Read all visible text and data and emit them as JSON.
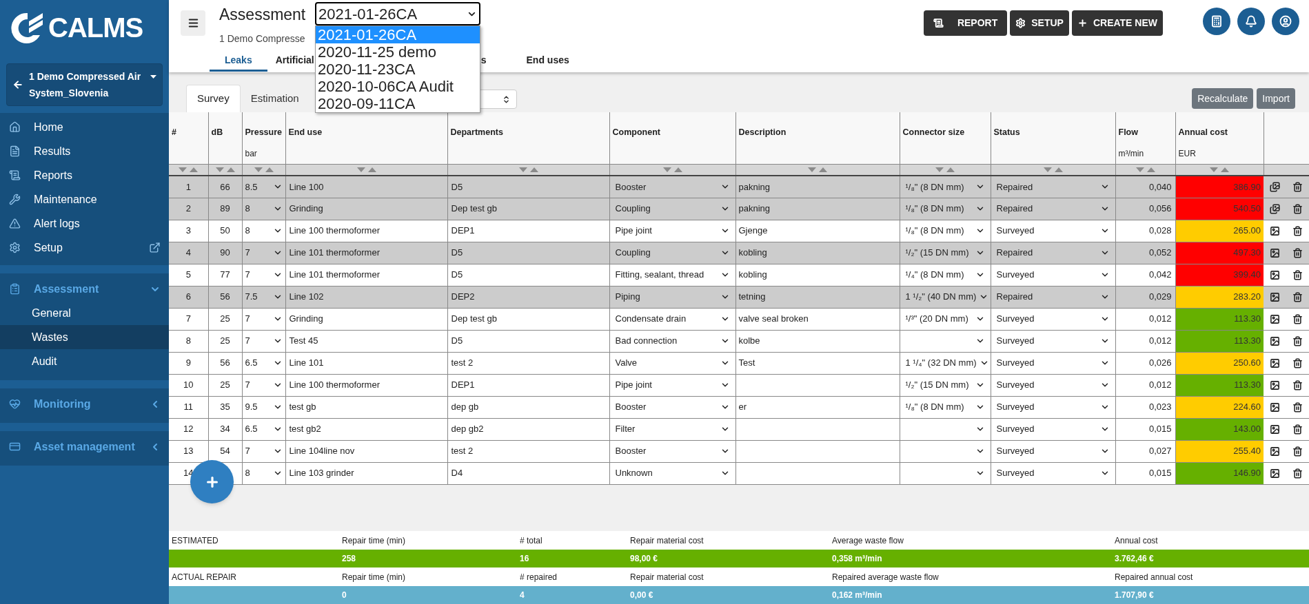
{
  "sidebar": {
    "logo": "CALMS",
    "project": "1 Demo Compressed Air System_Slovenia",
    "nav": [
      {
        "label": "Home",
        "external": false
      },
      {
        "label": "Results",
        "external": false
      },
      {
        "label": "Reports",
        "external": false
      },
      {
        "label": "Maintenance",
        "external": false
      },
      {
        "label": "Alert logs",
        "external": false
      },
      {
        "label": "Setup",
        "external": true
      }
    ],
    "sections": [
      {
        "label": "Assessment",
        "expanded": true,
        "children": [
          {
            "label": "General",
            "selected": false
          },
          {
            "label": "Wastes",
            "selected": true
          },
          {
            "label": "Audit",
            "selected": false
          }
        ]
      },
      {
        "label": "Monitoring",
        "expanded": false
      },
      {
        "label": "Asset management",
        "expanded": false
      }
    ]
  },
  "header": {
    "title": "Assessment",
    "subtitle": "1 Demo Compresse",
    "select": {
      "value": "2021-01-26CA",
      "expanded": true,
      "options": [
        {
          "label": "2021-01-26CA",
          "selected": true
        },
        {
          "label": "2020-11-25 demo",
          "selected": false
        },
        {
          "label": "2020-11-23CA",
          "selected": false
        },
        {
          "label": "2020-10-06CA Audit",
          "selected": false
        },
        {
          "label": "2020-09-11CA",
          "selected": false
        }
      ]
    },
    "tabs": [
      {
        "label": "Leaks",
        "selected": true
      },
      {
        "label": "Artificial",
        "selected": false
      },
      {
        "label": "s",
        "selected": false
      },
      {
        "label": "End uses",
        "selected": false
      }
    ],
    "buttons": [
      "REPORT",
      "SETUP",
      "CREATE NEW"
    ]
  },
  "subtabs": [
    {
      "label": "Survey",
      "selected": true
    },
    {
      "label": "Estimation",
      "selected": false
    }
  ],
  "actions": [
    "Recalculate",
    "Import"
  ],
  "table": {
    "columns": [
      {
        "label": "#"
      },
      {
        "label": "dB"
      },
      {
        "label": "Pressure",
        "unit": "bar"
      },
      {
        "label": "End use"
      },
      {
        "label": "Departments"
      },
      {
        "label": "Component"
      },
      {
        "label": "Description"
      },
      {
        "label": "Connector size"
      },
      {
        "label": "Status"
      },
      {
        "label": "Flow",
        "unit": "m³/min"
      },
      {
        "label": "Annual cost",
        "unit": "EUR"
      }
    ],
    "rows": [
      {
        "num": "1",
        "db": "66",
        "pressure": "8.5",
        "end_use": "Line 100",
        "department": "D5",
        "component": "Booster",
        "description": "pakning",
        "connector": "¹/₈\" (8 DN mm)",
        "status": "Repaired",
        "flow": "0,040",
        "annual_cost": "386.90",
        "color": "#ff0000",
        "repaired": true,
        "gallery": true
      },
      {
        "num": "2",
        "db": "89",
        "pressure": "8",
        "end_use": "Grinding",
        "department": "Dep test gb",
        "component": "Coupling",
        "description": "pakning",
        "connector": "¹/₈\" (8 DN mm)",
        "status": "Repaired",
        "flow": "0,056",
        "annual_cost": "540.50",
        "color": "#ff0000",
        "repaired": true,
        "gallery": true
      },
      {
        "num": "3",
        "db": "50",
        "pressure": "8",
        "end_use": "Line 100 thermoformer",
        "department": "DEP1",
        "component": "Pipe joint",
        "description": "Gjenge",
        "connector": "¹/₈\" (8 DN mm)",
        "status": "Surveyed",
        "flow": "0,028",
        "annual_cost": "265.00",
        "color": "#ffcc00",
        "repaired": false,
        "gallery": false
      },
      {
        "num": "4",
        "db": "90",
        "pressure": "7",
        "end_use": "Line 101 thermoformer",
        "department": "D5",
        "component": "Coupling",
        "description": "kobling",
        "connector": "¹/₂\" (15 DN mm)",
        "status": "Repaired",
        "flow": "0,052",
        "annual_cost": "497.30",
        "color": "#ff0000",
        "repaired": true,
        "gallery": false
      },
      {
        "num": "5",
        "db": "77",
        "pressure": "7",
        "end_use": "Line 101 thermoformer",
        "department": "D5",
        "component": "Fitting, sealant, thread",
        "description": "kobling",
        "connector": "¹/₄\" (8 DN mm)",
        "status": "Surveyed",
        "flow": "0,042",
        "annual_cost": "399.40",
        "color": "#ff0000",
        "repaired": false,
        "gallery": false
      },
      {
        "num": "6",
        "db": "56",
        "pressure": "7.5",
        "end_use": "Line 102",
        "department": "DEP2",
        "component": "Piping",
        "description": "tetning",
        "connector": "1 ¹/₂\" (40 DN mm)",
        "status": "Repaired",
        "flow": "0,029",
        "annual_cost": "283.20",
        "color": "#ffcc00",
        "repaired": true,
        "gallery": false
      },
      {
        "num": "7",
        "db": "25",
        "pressure": "7",
        "end_use": "Grinding",
        "department": "Dep test gb",
        "component": "Condensate drain",
        "description": "valve seal broken",
        "connector": "¹/³\" (20 DN mm)",
        "status": "Surveyed",
        "flow": "0,012",
        "annual_cost": "113.30",
        "color": "#66b000",
        "repaired": false,
        "gallery": false
      },
      {
        "num": "8",
        "db": "25",
        "pressure": "7",
        "end_use": "Test 45",
        "department": "D5",
        "component": "Bad connection",
        "description": "kolbe",
        "status": "Surveyed",
        "flow": "0,012",
        "annual_cost": "113.30",
        "color": "#66b000",
        "repaired": false,
        "gallery": false
      },
      {
        "num": "9",
        "db": "56",
        "pressure": "6.5",
        "end_use": "Line 101",
        "department": "test 2",
        "component": "Valve",
        "description": "Test",
        "connector": "1 ¹/₄\" (32 DN mm)",
        "status": "Surveyed",
        "flow": "0,026",
        "annual_cost": "250.60",
        "color": "#ffcc00",
        "repaired": false,
        "gallery": false
      },
      {
        "num": "10",
        "db": "25",
        "pressure": "7",
        "end_use": "Line 100 thermoformer",
        "department": "DEP1",
        "component": "Pipe joint",
        "connector": "¹/₂\" (15 DN mm)",
        "status": "Surveyed",
        "flow": "0,012",
        "annual_cost": "113.30",
        "color": "#66b000",
        "repaired": false,
        "gallery": false
      },
      {
        "num": "11",
        "db": "35",
        "pressure": "9.5",
        "end_use": "test gb",
        "department": "dep gb",
        "component": "Booster",
        "description": "er",
        "connector": "¹/₈\" (8 DN mm)",
        "status": "Surveyed",
        "flow": "0,023",
        "annual_cost": "224.60",
        "color": "#ffcc00",
        "repaired": false,
        "gallery": false
      },
      {
        "num": "12",
        "db": "34",
        "pressure": "6.5",
        "end_use": "test gb2",
        "department": "dep gb2",
        "component": "Filter",
        "status": "Surveyed",
        "flow": "0,015",
        "annual_cost": "143.00",
        "color": "#66b000",
        "repaired": false,
        "gallery": false
      },
      {
        "num": "13",
        "db": "54",
        "pressure": "7",
        "end_use": "Line 104line nov",
        "department": "test 2",
        "component": "Booster",
        "status": "Surveyed",
        "flow": "0,027",
        "annual_cost": "255.40",
        "color": "#ffcc00",
        "repaired": false,
        "gallery": false
      },
      {
        "num": "14",
        "pressure": "8",
        "end_use": "Line 103 grinder",
        "department": "D4",
        "component": "Unknown",
        "status": "Surveyed",
        "flow": "0,015",
        "annual_cost": "146.90",
        "color": "#66b000",
        "repaired": false,
        "gallery": false
      }
    ]
  },
  "summary": [
    {
      "label": "ESTIMATED",
      "color": "#66b000",
      "headings": [
        "Repair time (min)",
        "# total",
        "Repair material cost",
        "Average waste flow",
        "Annual cost"
      ],
      "values": [
        "258",
        "16",
        "98,00 €",
        "0,358 m³/min",
        "3.762,46 €"
      ]
    },
    {
      "label": "ACTUAL REPAIR",
      "color": "#63b0cc",
      "headings": [
        "Repair time (min)",
        "# repaired",
        "Repair material cost",
        "Repaired average waste flow",
        "Repaired annual cost"
      ],
      "values": [
        "0",
        "4",
        "0,00 €",
        "0,162 m³/min",
        "1.707,90 €"
      ]
    }
  ]
}
